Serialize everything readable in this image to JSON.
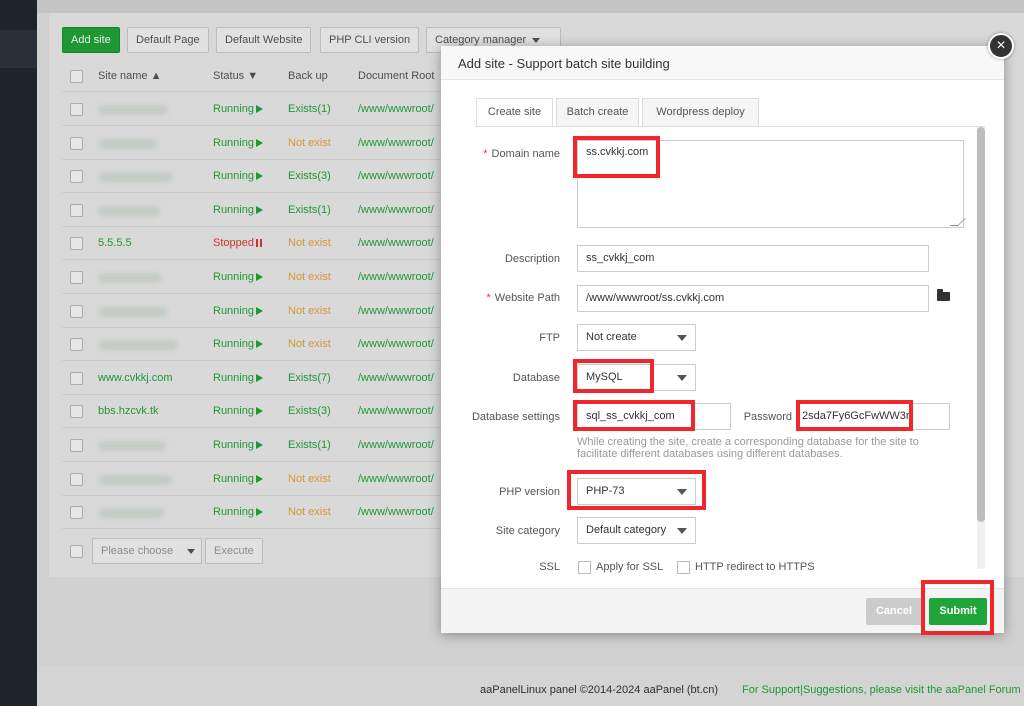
{
  "toolbar": {
    "add_site": "Add site",
    "default_page": "Default Page",
    "default_website": "Default Website",
    "php_cli": "PHP CLI version",
    "category_manager": "Category manager"
  },
  "table": {
    "headers": {
      "site_name": "Site name",
      "status": "Status",
      "backup": "Back up",
      "docroot": "Document Root"
    },
    "rows": [
      {
        "name": "",
        "status": "Running",
        "backup": "Exists(1)",
        "path": "/www/wwwroot/"
      },
      {
        "name": "",
        "status": "Running",
        "backup": "Not exist",
        "path": "/www/wwwroot/"
      },
      {
        "name": "",
        "status": "Running",
        "backup": "Exists(3)",
        "path": "/www/wwwroot/"
      },
      {
        "name": "",
        "status": "Running",
        "backup": "Exists(1)",
        "path": "/www/wwwroot/"
      },
      {
        "name": "5.5.5.5",
        "status": "Stopped",
        "backup": "Not exist",
        "path": "/www/wwwroot/"
      },
      {
        "name": "",
        "status": "Running",
        "backup": "Not exist",
        "path": "/www/wwwroot/"
      },
      {
        "name": "",
        "status": "Running",
        "backup": "Not exist",
        "path": "/www/wwwroot/"
      },
      {
        "name": "",
        "status": "Running",
        "backup": "Not exist",
        "path": "/www/wwwroot/"
      },
      {
        "name": "www.cvkkj.com",
        "status": "Running",
        "backup": "Exists(7)",
        "path": "/www/wwwroot/"
      },
      {
        "name": "bbs.hzcvk.tk",
        "status": "Running",
        "backup": "Exists(3)",
        "path": "/www/wwwroot/"
      },
      {
        "name": "",
        "status": "Running",
        "backup": "Exists(1)",
        "path": "/www/wwwroot/"
      },
      {
        "name": "",
        "status": "Running",
        "backup": "Not exist",
        "path": "/www/wwwroot/"
      },
      {
        "name": "",
        "status": "Running",
        "backup": "Not exist",
        "path": "/www/wwwroot/"
      }
    ],
    "batch_select": "Please choose",
    "execute": "Execute"
  },
  "modal": {
    "title": "Add site - Support batch site building",
    "tabs": [
      "Create site",
      "Batch create",
      "Wordpress deploy"
    ],
    "domain_label": "Domain name",
    "domain_value": "ss.cvkkj.com",
    "description_label": "Description",
    "description_value": "ss_cvkkj_com",
    "path_label": "Website Path",
    "path_value": "/www/wwwroot/ss.cvkkj.com",
    "ftp_label": "FTP",
    "ftp_value": "Not create",
    "database_label": "Database",
    "database_value": "MySQL",
    "db_settings_label": "Database settings",
    "db_user_value": "sql_ss_cvkkj_com",
    "password_label": "Password",
    "password_value": "2sda7Fy6GcFwWW3r",
    "db_hint": "While creating the site, create a corresponding database for the site to facilitate different databases using different databases.",
    "php_label": "PHP version",
    "php_value": "PHP-73",
    "category_label": "Site category",
    "category_value": "Default category",
    "ssl_label": "SSL",
    "ssl_apply": "Apply for SSL",
    "ssl_redirect": "HTTP redirect to HTTPS",
    "cancel": "Cancel",
    "submit": "Submit",
    "close_icon": "close-icon"
  },
  "footer": {
    "copyright": "aaPanelLinux panel ©2014-2024 aaPanel (bt.cn)",
    "support": "For Support|Suggestions, please visit the aaPanel Forum"
  },
  "colors": {
    "accent": "#20a53a",
    "stopped": "#e0382c",
    "not_exist": "#e8a43c",
    "highlight": "#f0282c"
  }
}
